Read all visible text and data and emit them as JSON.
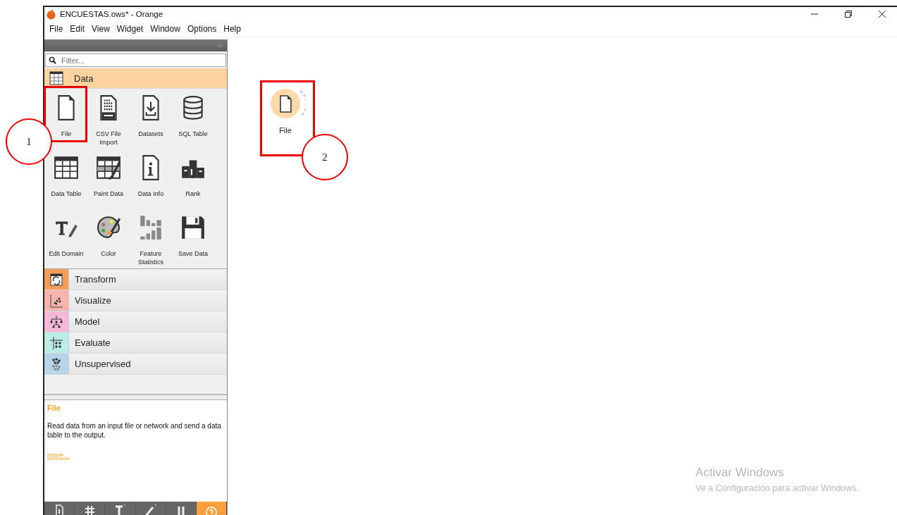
{
  "window": {
    "title": "ENCUESTAS.ows* - Orange"
  },
  "menu_bar": [
    "File",
    "Edit",
    "View",
    "Widget",
    "Window",
    "Options",
    "Help"
  ],
  "sidebar": {
    "filter": {
      "placeholder": "Filter..."
    },
    "categories": [
      {
        "name": "Data",
        "kind": "data",
        "expanded": true,
        "color": "#fdd4a0",
        "widgets": [
          {
            "label": "File",
            "kind": "file"
          },
          {
            "label": "CSV File Import",
            "kind": "csv"
          },
          {
            "label": "Datasets",
            "kind": "datasets"
          },
          {
            "label": "SQL Table",
            "kind": "sql"
          },
          {
            "label": "Data Table",
            "kind": "table"
          },
          {
            "label": "Paint Data",
            "kind": "paint"
          },
          {
            "label": "Data Info",
            "kind": "info"
          },
          {
            "label": "Rank",
            "kind": "rank"
          },
          {
            "label": "Edit Domain",
            "kind": "edit"
          },
          {
            "label": "Color",
            "kind": "palette"
          },
          {
            "label": "Feature Statistics",
            "kind": "stats"
          },
          {
            "label": "Save Data",
            "kind": "save"
          }
        ]
      },
      {
        "name": "Transform",
        "kind": "transform",
        "expanded": false,
        "color": "#f59c58"
      },
      {
        "name": "Visualize",
        "kind": "visualize",
        "expanded": false,
        "color": "#f8b4aa"
      },
      {
        "name": "Model",
        "kind": "model",
        "expanded": false,
        "color": "#f4b8d8"
      },
      {
        "name": "Evaluate",
        "kind": "evaluate",
        "expanded": false,
        "color": "#baede6"
      },
      {
        "name": "Unsupervised",
        "kind": "unsupervised",
        "expanded": false,
        "color": "#b8d4e8"
      }
    ]
  },
  "description": {
    "title": "File",
    "text": "Read data from an input file or network and send a data table to the output.",
    "link": "more..."
  },
  "toolbar": [
    {
      "kind": "info",
      "on": false
    },
    {
      "kind": "grid",
      "on": false
    },
    {
      "kind": "text",
      "on": false
    },
    {
      "kind": "pen",
      "on": false
    },
    {
      "kind": "pause",
      "on": false
    },
    {
      "kind": "help",
      "on": true
    }
  ],
  "canvas": {
    "nodes": [
      {
        "label": "File",
        "kind": "file"
      }
    ]
  },
  "annotations": [
    {
      "number": "1"
    },
    {
      "number": "2"
    }
  ],
  "activation_notice": {
    "title": "Activar Windows",
    "text": "Ve a Configuración para activar Windows."
  }
}
